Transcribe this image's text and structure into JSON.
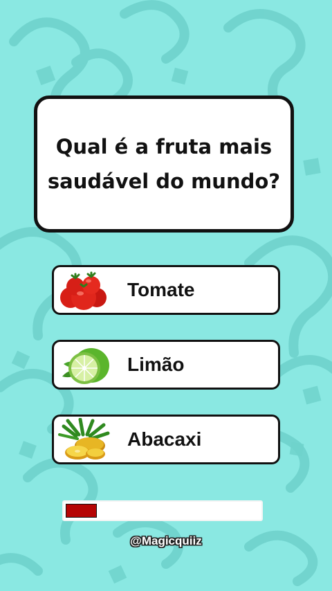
{
  "quiz": {
    "question": "Qual é a fruta mais saudável do mundo?",
    "options": [
      {
        "label": "Tomate",
        "icon": "tomato-icon"
      },
      {
        "label": "Limão",
        "icon": "lime-icon"
      },
      {
        "label": "Abacaxi",
        "icon": "pineapple-icon"
      }
    ],
    "progress_fraction": 0.16
  },
  "footer": {
    "handle": "@Magicquiiz"
  },
  "colors": {
    "background": "#8ae8e2",
    "pattern": "#6fd2cc",
    "progress_fill": "#b50404",
    "card_border": "#111111"
  }
}
